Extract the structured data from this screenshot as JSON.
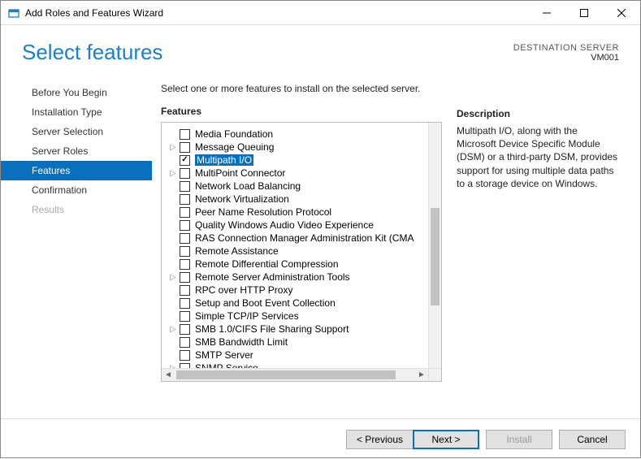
{
  "window": {
    "title": "Add Roles and Features Wizard"
  },
  "header": {
    "page_title": "Select features",
    "dest_label": "DESTINATION SERVER",
    "dest_name": "VM001"
  },
  "nav": [
    {
      "label": "Before You Begin",
      "state": "normal"
    },
    {
      "label": "Installation Type",
      "state": "normal"
    },
    {
      "label": "Server Selection",
      "state": "normal"
    },
    {
      "label": "Server Roles",
      "state": "normal"
    },
    {
      "label": "Features",
      "state": "selected"
    },
    {
      "label": "Confirmation",
      "state": "normal"
    },
    {
      "label": "Results",
      "state": "disabled"
    }
  ],
  "intro": "Select one or more features to install on the selected server.",
  "features_heading": "Features",
  "description_heading": "Description",
  "description_text": "Multipath I/O, along with the Microsoft Device Specific Module (DSM) or a third-party DSM, provides support for using multiple data paths to a storage device on Windows.",
  "features": [
    {
      "label": "Media Foundation",
      "checked": false,
      "expandable": false,
      "selected": false
    },
    {
      "label": "Message Queuing",
      "checked": false,
      "expandable": true,
      "selected": false
    },
    {
      "label": "Multipath I/O",
      "checked": true,
      "expandable": false,
      "selected": true
    },
    {
      "label": "MultiPoint Connector",
      "checked": false,
      "expandable": true,
      "selected": false
    },
    {
      "label": "Network Load Balancing",
      "checked": false,
      "expandable": false,
      "selected": false
    },
    {
      "label": "Network Virtualization",
      "checked": false,
      "expandable": false,
      "selected": false
    },
    {
      "label": "Peer Name Resolution Protocol",
      "checked": false,
      "expandable": false,
      "selected": false
    },
    {
      "label": "Quality Windows Audio Video Experience",
      "checked": false,
      "expandable": false,
      "selected": false
    },
    {
      "label": "RAS Connection Manager Administration Kit (CMA",
      "checked": false,
      "expandable": false,
      "selected": false
    },
    {
      "label": "Remote Assistance",
      "checked": false,
      "expandable": false,
      "selected": false
    },
    {
      "label": "Remote Differential Compression",
      "checked": false,
      "expandable": false,
      "selected": false
    },
    {
      "label": "Remote Server Administration Tools",
      "checked": false,
      "expandable": true,
      "selected": false
    },
    {
      "label": "RPC over HTTP Proxy",
      "checked": false,
      "expandable": false,
      "selected": false
    },
    {
      "label": "Setup and Boot Event Collection",
      "checked": false,
      "expandable": false,
      "selected": false
    },
    {
      "label": "Simple TCP/IP Services",
      "checked": false,
      "expandable": false,
      "selected": false
    },
    {
      "label": "SMB 1.0/CIFS File Sharing Support",
      "checked": false,
      "expandable": true,
      "selected": false
    },
    {
      "label": "SMB Bandwidth Limit",
      "checked": false,
      "expandable": false,
      "selected": false
    },
    {
      "label": "SMTP Server",
      "checked": false,
      "expandable": false,
      "selected": false
    },
    {
      "label": "SNMP Service",
      "checked": false,
      "expandable": true,
      "selected": false
    }
  ],
  "buttons": {
    "previous": "< Previous",
    "next": "Next >",
    "install": "Install",
    "cancel": "Cancel"
  }
}
